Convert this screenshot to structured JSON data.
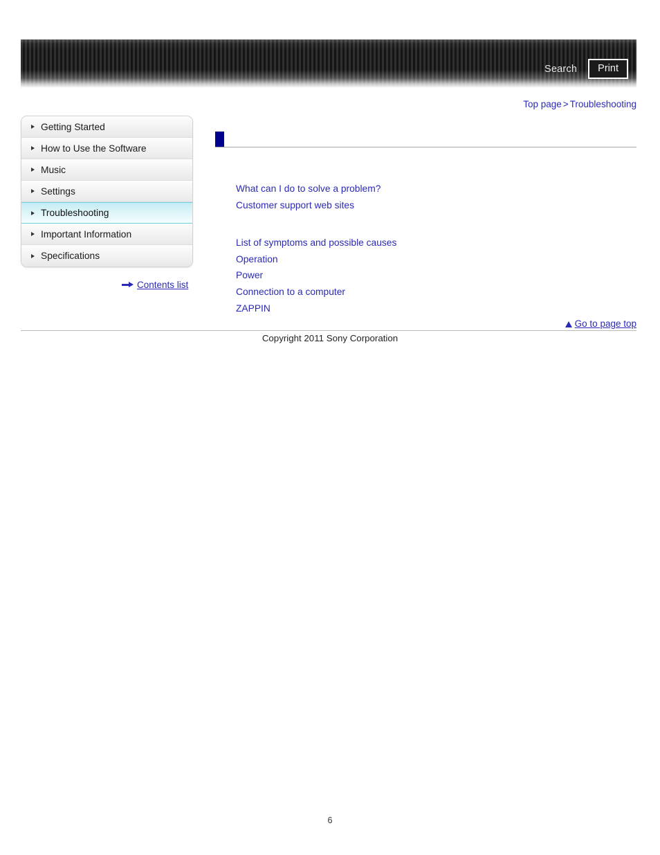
{
  "header": {
    "search_label": "Search",
    "print_label": "Print",
    "icons": {
      "search": "search-icon",
      "print": "print-icon"
    }
  },
  "breadcrumb": {
    "top_page": "Top page",
    "separator": ">",
    "current": "Troubleshooting"
  },
  "sidebar": {
    "items": [
      {
        "label": "Getting Started",
        "active": false
      },
      {
        "label": "How to Use the Software",
        "active": false
      },
      {
        "label": "Music",
        "active": false
      },
      {
        "label": "Settings",
        "active": false
      },
      {
        "label": "Troubleshooting",
        "active": true
      },
      {
        "label": "Important Information",
        "active": false
      },
      {
        "label": "Specifications",
        "active": false
      }
    ],
    "contents_list_label": "Contents list",
    "contents_list_icon": "arrow-right-icon"
  },
  "main": {
    "title": "",
    "link_groups": [
      {
        "links": [
          "What can I do to solve a problem?",
          "Customer support web sites"
        ]
      },
      {
        "links": [
          "List of symptoms and possible causes",
          "Operation",
          "Power",
          "Connection to a computer",
          "ZAPPIN"
        ]
      }
    ]
  },
  "footer": {
    "go_to_page_top": "Go to page top",
    "go_to_page_top_icon": "triangle-up-icon",
    "copyright": "Copyright 2011 Sony Corporation",
    "page_number": "6"
  },
  "colors": {
    "link": "#2a2ab4",
    "title_marker": "#00008f",
    "active_nav": "#c4edf4",
    "header_dark": "#151515"
  }
}
